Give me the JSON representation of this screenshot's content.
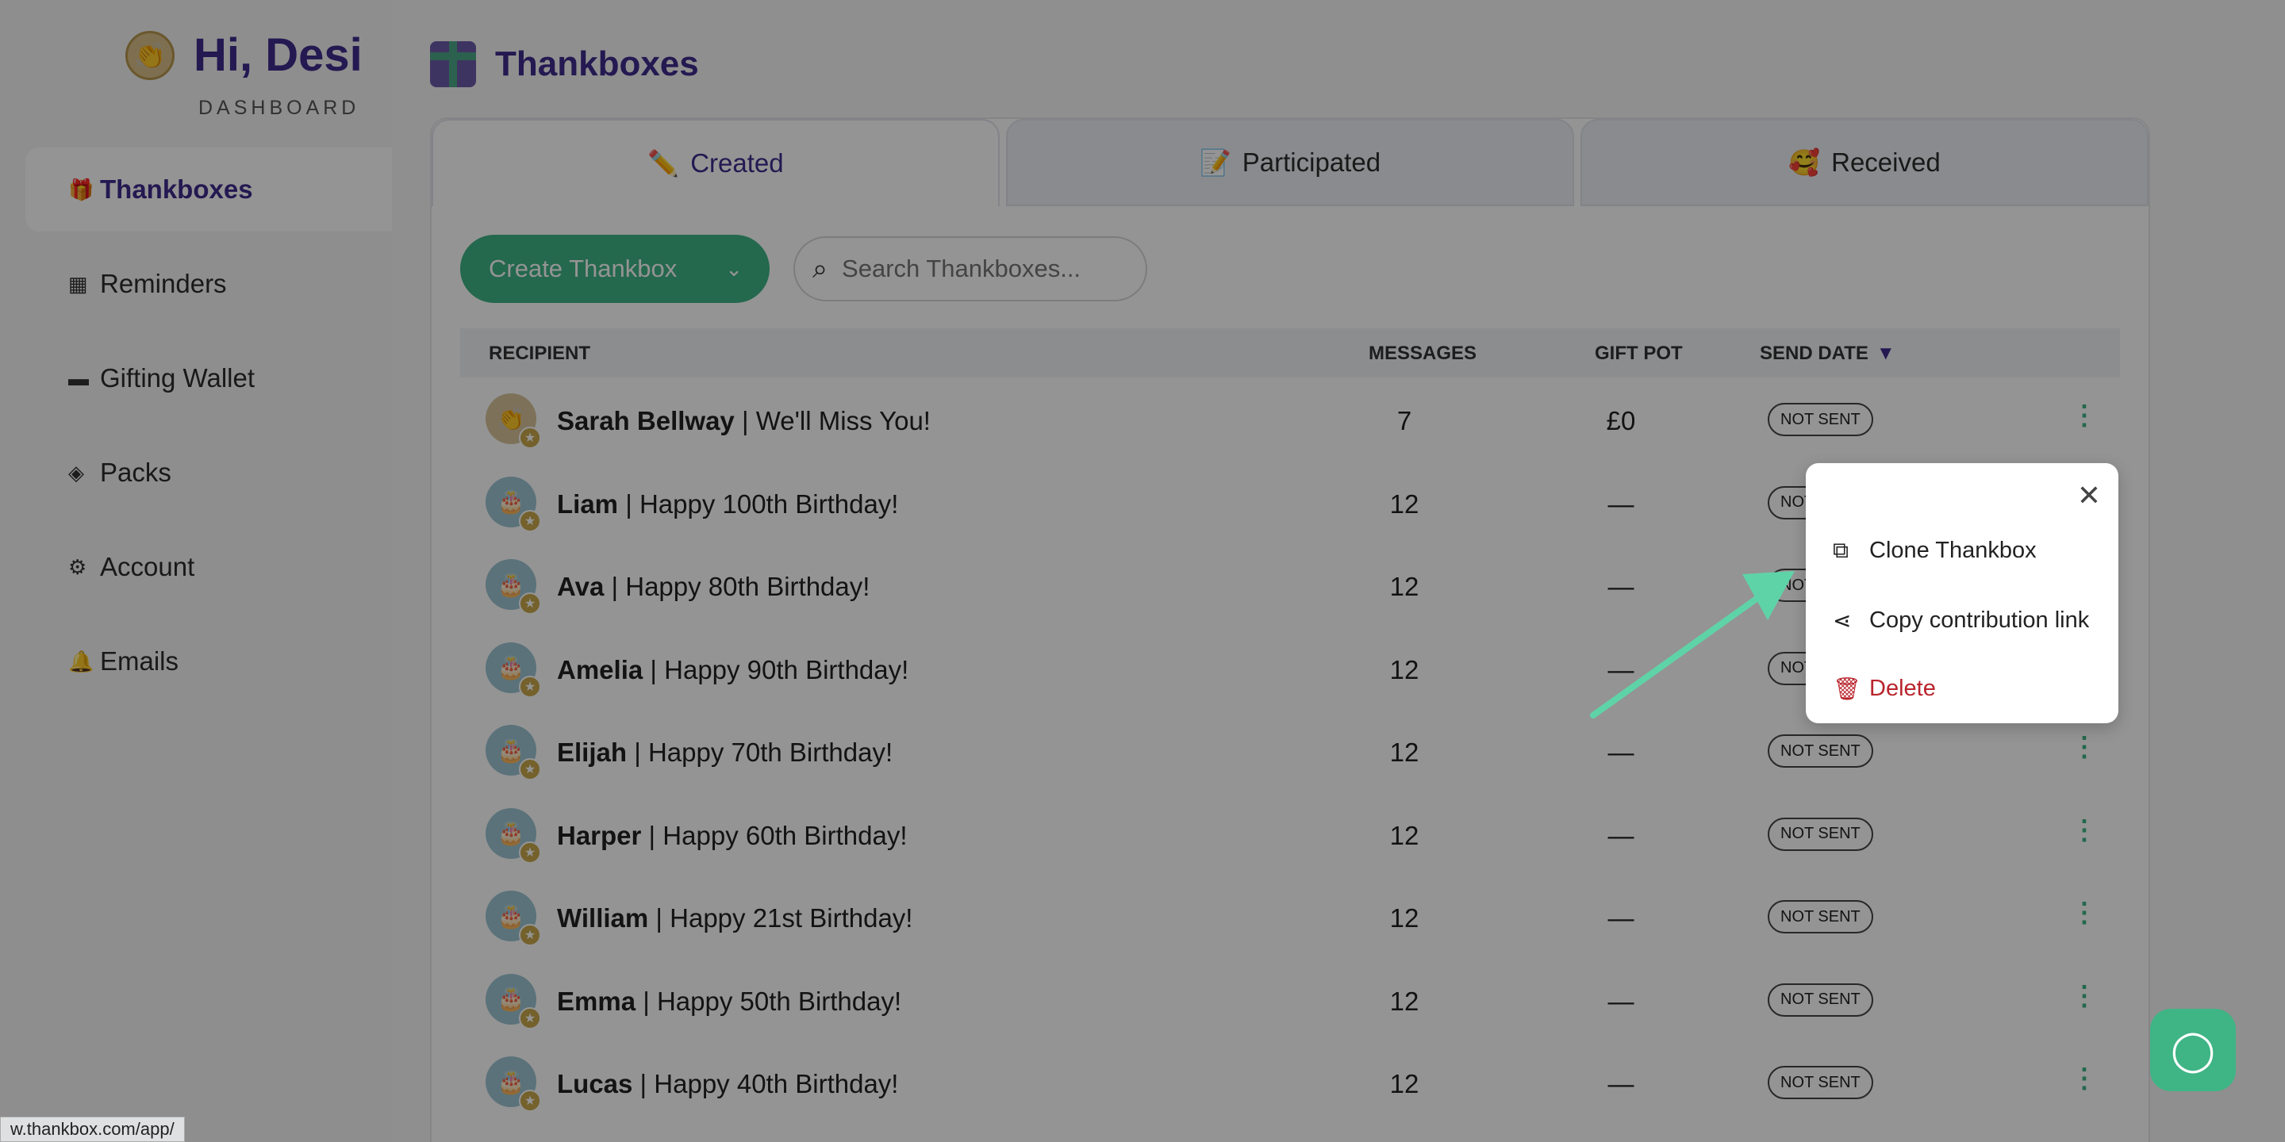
{
  "sidebar": {
    "greeting": "Hi, Desi",
    "subtitle": "DASHBOARD",
    "items": [
      {
        "label": "Thankboxes",
        "icon": "gift-icon",
        "active": true
      },
      {
        "label": "Reminders",
        "icon": "calendar-icon"
      },
      {
        "label": "Gifting Wallet",
        "icon": "wallet-icon"
      },
      {
        "label": "Packs",
        "icon": "layers-icon"
      },
      {
        "label": "Account",
        "icon": "gear-icon"
      },
      {
        "label": "Emails",
        "icon": "bell-icon"
      }
    ]
  },
  "page": {
    "title": "Thankboxes"
  },
  "tabs": [
    {
      "label": "Created",
      "emoji": "✏️",
      "active": true
    },
    {
      "label": "Participated",
      "emoji": "📝"
    },
    {
      "label": "Received",
      "emoji": "🥰"
    }
  ],
  "toolbar": {
    "create_label": "Create Thankbox",
    "search_placeholder": "Search Thankboxes..."
  },
  "table": {
    "headers": {
      "recipient": "RECIPIENT",
      "messages": "MESSAGES",
      "gift_pot": "GIFT POT",
      "send_date": "SEND DATE"
    },
    "rows": [
      {
        "name": "Sarah Bellway",
        "title": " | We'll Miss You!",
        "messages": "7",
        "gift": "£0",
        "status": "NOT SENT"
      },
      {
        "name": "Liam",
        "title": " | Happy 100th Birthday!",
        "messages": "12",
        "gift": "—",
        "status": "NOT SENT"
      },
      {
        "name": "Ava",
        "title": " | Happy 80th Birthday!",
        "messages": "12",
        "gift": "—",
        "status": "NOT SENT"
      },
      {
        "name": "Amelia",
        "title": " | Happy 90th Birthday!",
        "messages": "12",
        "gift": "—",
        "status": "NOT SENT"
      },
      {
        "name": "Elijah",
        "title": " | Happy 70th Birthday!",
        "messages": "12",
        "gift": "—",
        "status": "NOT SENT"
      },
      {
        "name": "Harper",
        "title": " | Happy 60th Birthday!",
        "messages": "12",
        "gift": "—",
        "status": "NOT SENT"
      },
      {
        "name": "William",
        "title": " | Happy 21st Birthday!",
        "messages": "12",
        "gift": "—",
        "status": "NOT SENT"
      },
      {
        "name": "Emma",
        "title": " | Happy 50th Birthday!",
        "messages": "12",
        "gift": "—",
        "status": "NOT SENT"
      },
      {
        "name": "Lucas",
        "title": " | Happy 40th Birthday!",
        "messages": "12",
        "gift": "—",
        "status": "NOT SENT"
      }
    ]
  },
  "menu": {
    "clone": "Clone Thankbox",
    "copy": "Copy contribution link",
    "delete": "Delete"
  },
  "status_url": "w.thankbox.com/app/",
  "colors": {
    "brand_purple": "#3e2b8c",
    "brand_green": "#3fb485",
    "danger": "#b9242c"
  }
}
